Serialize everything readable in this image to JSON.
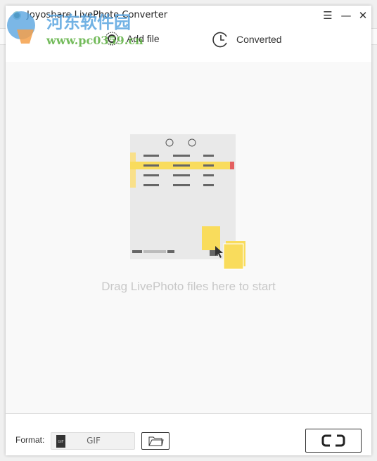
{
  "window": {
    "title": "Joyoshare LivePhoto Converter"
  },
  "nav": {
    "add_file": "Add file",
    "converted": "Converted"
  },
  "main": {
    "drop_hint": "Drag LivePhoto files here to start"
  },
  "footer": {
    "format_label": "Format:",
    "format_value": "GIF",
    "format_icon_text": "GIF"
  },
  "watermark": {
    "name": "河东软件园",
    "url": "www.pc0359.cn"
  },
  "colors": {
    "accent_yellow": "#f9dc5c",
    "highlight_red": "#e46060"
  }
}
